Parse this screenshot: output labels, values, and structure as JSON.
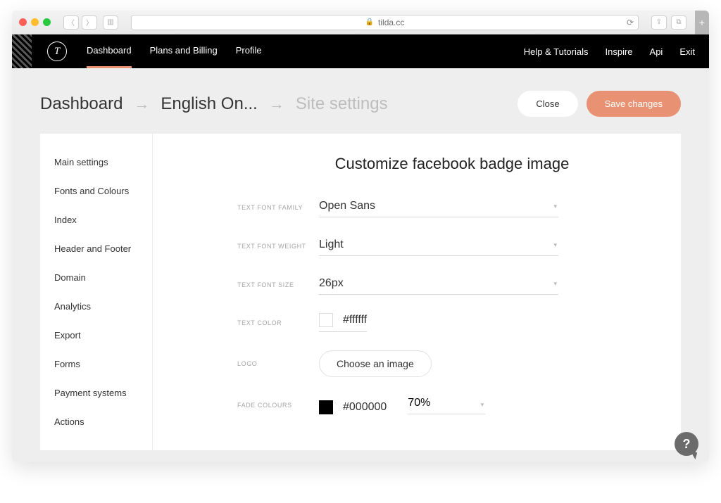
{
  "browser": {
    "url": "tilda.cc"
  },
  "nav": {
    "left": [
      "Dashboard",
      "Plans and Billing",
      "Profile"
    ],
    "right": [
      "Help & Tutorials",
      "Inspire",
      "Api",
      "Exit"
    ]
  },
  "breadcrumb": {
    "root": "Dashboard",
    "project": "English On...",
    "page": "Site settings"
  },
  "actions": {
    "close": "Close",
    "save": "Save changes"
  },
  "sidebar": {
    "items": [
      "Main settings",
      "Fonts and Colours",
      "Index",
      "Header and Footer",
      "Domain",
      "Analytics",
      "Export",
      "Forms",
      "Payment systems",
      "Actions"
    ]
  },
  "content": {
    "title": "Customize facebook badge image",
    "labels": {
      "font_family": "TEXT FONT FAMILY",
      "font_weight": "TEXT FONT WEIGHT",
      "font_size": "TEXT FONT SIZE",
      "text_color": "TEXT COLOR",
      "logo": "LOGO",
      "fade": "FADE COLOURS"
    },
    "values": {
      "font_family": "Open Sans",
      "font_weight": "Light",
      "font_size": "26px",
      "text_color": "#ffffff",
      "logo_button": "Choose an image",
      "fade_color": "#000000",
      "fade_opacity": "70%"
    }
  },
  "help": "?"
}
